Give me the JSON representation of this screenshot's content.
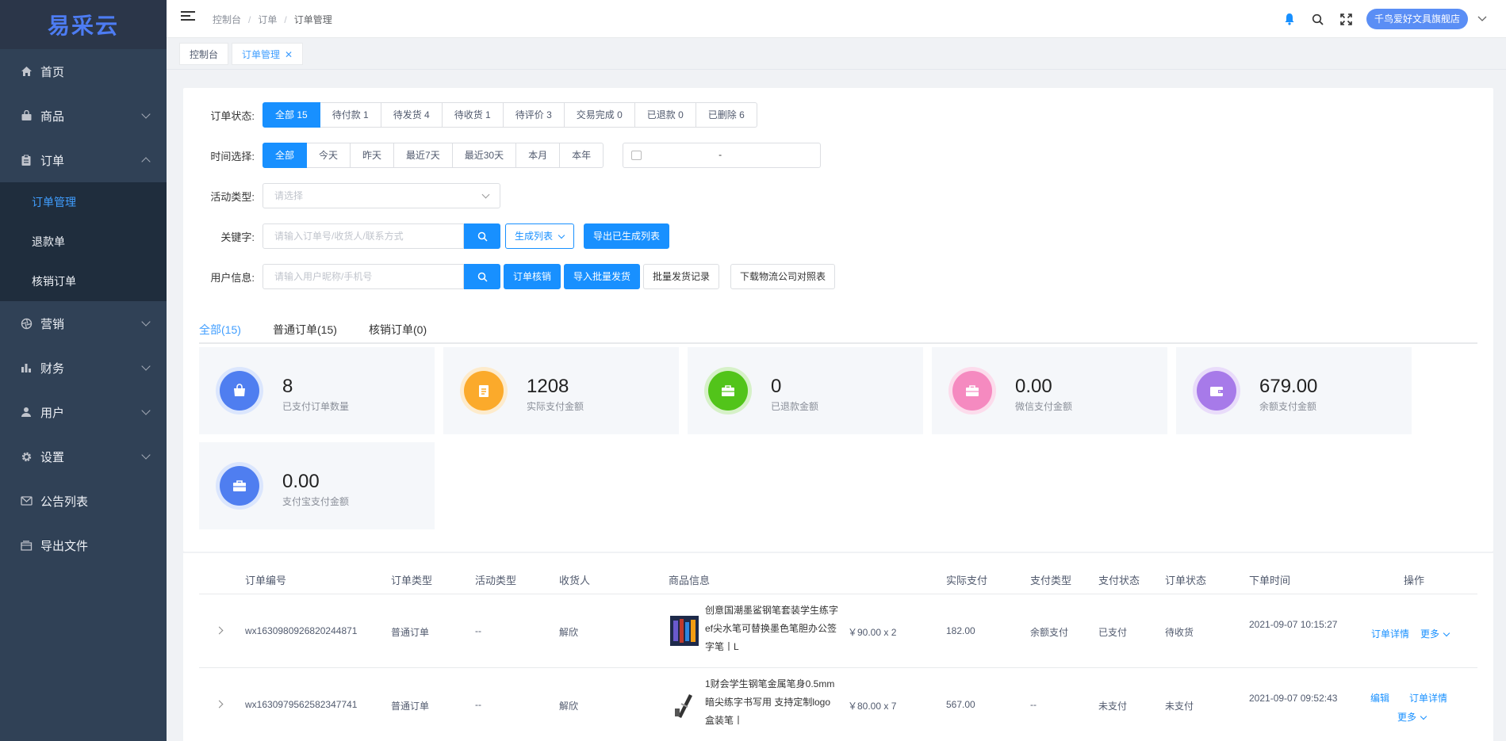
{
  "app": {
    "logo": "易采云"
  },
  "sidebar": {
    "items": [
      {
        "label": "首页",
        "icon": "home-icon"
      },
      {
        "label": "商品",
        "icon": "bag-icon"
      },
      {
        "label": "订单",
        "icon": "clipboard-icon"
      },
      {
        "label": "营销",
        "icon": "aperture-icon"
      },
      {
        "label": "财务",
        "icon": "bar-chart-icon"
      },
      {
        "label": "用户",
        "icon": "user-icon"
      },
      {
        "label": "设置",
        "icon": "gear-icon"
      },
      {
        "label": "公告列表",
        "icon": "mail-icon"
      },
      {
        "label": "导出文件",
        "icon": "folder-icon"
      }
    ],
    "order_sub": [
      "订单管理",
      "退款单",
      "核销订单"
    ]
  },
  "header": {
    "breadcrumb": [
      "控制台",
      "订单",
      "订单管理"
    ],
    "store": "千鸟爱好文具旗舰店"
  },
  "tags": {
    "home": "控制台",
    "current": "订单管理"
  },
  "filters": {
    "status_label": "订单状态:",
    "status_options": [
      "全部 15",
      "待付款 1",
      "待发货 4",
      "待收货 1",
      "待评价 3",
      "交易完成 0",
      "已退款 0",
      "已删除 6"
    ],
    "time_label": "时间选择:",
    "time_options": [
      "全部",
      "今天",
      "昨天",
      "最近7天",
      "最近30天",
      "本月",
      "本年"
    ],
    "date_sep": "-",
    "activity_label": "活动类型:",
    "activity_placeholder": "请选择",
    "keyword_label": "关键字:",
    "keyword_placeholder": "请输入订单号/收货人/联系方式",
    "generate_list": "生成列表",
    "export_generated": "导出已生成列表",
    "user_label": "用户信息:",
    "user_placeholder": "请输入用户昵称/手机号",
    "verify_btn": "订单核销",
    "import_ship": "导入批量发货",
    "ship_record": "批量发货记录",
    "download_logistics": "下载物流公司对照表"
  },
  "tabs": [
    "全部(15)",
    "普通订单(15)",
    "核销订单(0)"
  ],
  "stats": [
    {
      "value": "8",
      "label": "已支付订单数量",
      "color": "#4f7ef0",
      "halo": "#dbe6fd"
    },
    {
      "value": "1208",
      "label": "实际支付金额",
      "color": "#fbaa2b",
      "halo": "#fdebcc"
    },
    {
      "value": "0",
      "label": "已退款金额",
      "color": "#52c41a",
      "halo": "#d6f1c8"
    },
    {
      "value": "0.00",
      "label": "微信支付金额",
      "color": "#f58ac0",
      "halo": "#fcdcec"
    },
    {
      "value": "679.00",
      "label": "余额支付金额",
      "color": "#a77ae9",
      "halo": "#e9dcfa"
    },
    {
      "value": "0.00",
      "label": "支付宝支付金额",
      "color": "#4f7ef0",
      "halo": "#dbe6fd"
    }
  ],
  "table": {
    "headers": [
      "订单编号",
      "订单类型",
      "活动类型",
      "收货人",
      "商品信息",
      "实际支付",
      "支付类型",
      "支付状态",
      "订单状态",
      "下单时间",
      "操作"
    ],
    "rows": [
      {
        "order_no": "wx1630980926820244871",
        "type": "普通订单",
        "activity": "--",
        "receiver": "解欣",
        "product": "创意国潮墨鲨钢笔套装学生练字ef尖水笔可替换墨色笔胆办公签字笔丨L",
        "price_qty": "￥90.00 x 2",
        "paid": "182.00",
        "pay_type": "余额支付",
        "pay_status": "已支付",
        "order_status": "待收货",
        "time": "2021-09-07 10:15:27",
        "actions": [
          "订单详情",
          "更多"
        ]
      },
      {
        "order_no": "wx1630979562582347741",
        "type": "普通订单",
        "activity": "--",
        "receiver": "解欣",
        "product": "1财会学生钢笔金属笔身0.5mm暗尖练字书写用 支持定制logo盒装笔丨",
        "price_qty": "￥80.00 x 7",
        "paid": "567.00",
        "pay_type": "--",
        "pay_status": "未支付",
        "order_status": "未支付",
        "time": "2021-09-07 09:52:43",
        "actions": [
          "编辑",
          "订单详情",
          "更多"
        ]
      }
    ]
  }
}
